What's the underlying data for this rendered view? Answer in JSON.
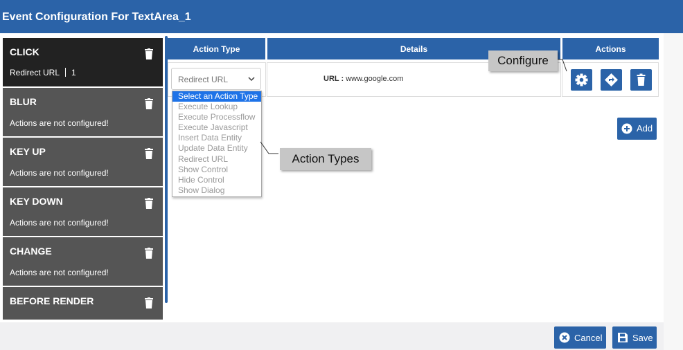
{
  "window": {
    "title": "Event Configuration For TextArea_1"
  },
  "events": [
    {
      "name": "CLICK",
      "status": "Redirect URL",
      "count": "1",
      "active": true,
      "delete_icon": "trash-icon"
    },
    {
      "name": "BLUR",
      "status": "Actions are not configured!",
      "active": false,
      "delete_icon": "trash-icon"
    },
    {
      "name": "KEY UP",
      "status": "Actions are not configured!",
      "active": false,
      "delete_icon": "trash-icon"
    },
    {
      "name": "KEY DOWN",
      "status": "Actions are not configured!",
      "active": false,
      "delete_icon": "trash-icon"
    },
    {
      "name": "CHANGE",
      "status": "Actions are not configured!",
      "active": false,
      "delete_icon": "trash-icon"
    },
    {
      "name": "BEFORE RENDER",
      "status": "",
      "active": false,
      "delete_icon": "trash-icon"
    }
  ],
  "table": {
    "columns": [
      "Action Type",
      "Details",
      "Actions"
    ],
    "row": {
      "action_type": "Redirect URL",
      "details_label": "URL :",
      "details_value": "www.google.com",
      "action_icons": [
        "gear-icon",
        "diamond-arrow-icon",
        "trash-icon"
      ]
    }
  },
  "dropdown": {
    "options": [
      "Select an Action Type",
      "Execute Lookup",
      "Execute Processflow",
      "Execute Javascript",
      "Insert Data Entity",
      "Update Data Entity",
      "Redirect URL",
      "Show Control",
      "Hide Control",
      "Show Dialog"
    ],
    "highlighted": "Select an Action Type"
  },
  "buttons": {
    "add": "Add",
    "cancel": "Cancel",
    "save": "Save"
  },
  "callouts": {
    "configure": "Configure",
    "action_types": "Action Types"
  },
  "colors": {
    "header_blue": "#2b63a8",
    "event_active": "#222222",
    "event_inactive": "#555555",
    "dropdown_highlight": "#1e73e8",
    "callout_gray": "#c6c6c6"
  }
}
